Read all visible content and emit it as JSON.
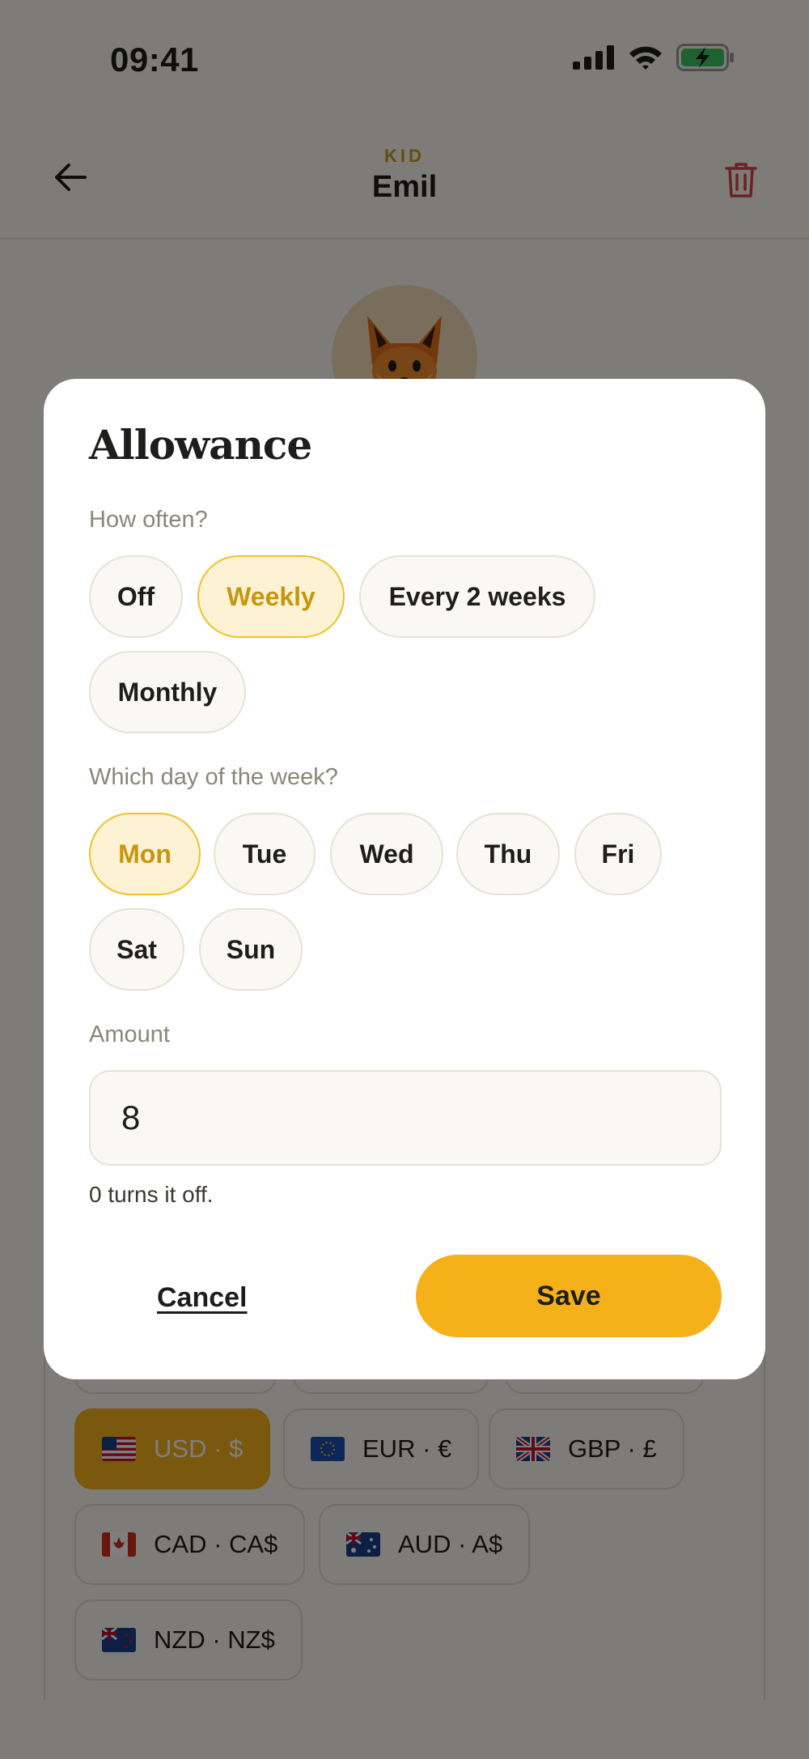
{
  "status_bar": {
    "time": "09:41"
  },
  "header": {
    "eyebrow": "KID",
    "title": "Emil"
  },
  "currencies": {
    "items": [
      {
        "code": "USD · $",
        "flag": "us-flag",
        "selected": true
      },
      {
        "code": "EUR · €",
        "flag": "eu-flag",
        "selected": false
      },
      {
        "code": "GBP · £",
        "flag": "uk-flag",
        "selected": false
      },
      {
        "code": "CAD · CA$",
        "flag": "ca-flag",
        "selected": false
      },
      {
        "code": "AUD · A$",
        "flag": "au-flag",
        "selected": false
      },
      {
        "code": "NZD · NZ$",
        "flag": "nz-flag",
        "selected": false
      }
    ]
  },
  "dialog": {
    "title": "Allowance",
    "frequency": {
      "label": "How often?",
      "options": [
        "Off",
        "Weekly",
        "Every 2 weeks",
        "Monthly"
      ],
      "selected": "Weekly"
    },
    "day": {
      "label": "Which day of the week?",
      "options": [
        "Mon",
        "Tue",
        "Wed",
        "Thu",
        "Fri",
        "Sat",
        "Sun"
      ],
      "selected": "Mon"
    },
    "amount": {
      "label": "Amount",
      "value": "8",
      "hint": "0 turns it off."
    },
    "cancel_label": "Cancel",
    "save_label": "Save"
  },
  "colors": {
    "accent": "#f5b11a",
    "danger": "#d64545",
    "eyebrow": "#c79a1b"
  }
}
